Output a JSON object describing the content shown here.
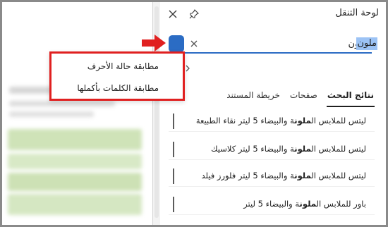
{
  "nav_pane": {
    "title": "لوحة التنقل",
    "close_icon": "close-icon",
    "pin_icon": "pin-icon"
  },
  "search": {
    "value": "ملون",
    "clear_icon": "close-icon",
    "options_icon": "chevron-icon"
  },
  "popup": {
    "items": [
      {
        "label": "مطابقة حالة الأحرف"
      },
      {
        "label": "مطابقة الكلمات بأكملها"
      }
    ]
  },
  "tabs": [
    {
      "label": "نتائج البحث",
      "active": true
    },
    {
      "label": "صفحات",
      "active": false
    },
    {
      "label": "خريطة المستند",
      "active": false
    }
  ],
  "results": [
    {
      "before": "ليتس للملابس ال",
      "match": "ملون",
      "after": "ة والبيضاء 5 ليتر نقاء الطبيعة"
    },
    {
      "before": "ليتس للملابس ال",
      "match": "ملون",
      "after": "ة والبيضاء 5 ليتر كلاسيك"
    },
    {
      "before": "ليتس للملابس ال",
      "match": "ملون",
      "after": "ة والبيضاء 5 ليتر فلورز فيلد"
    },
    {
      "before": "باور للملابس ال",
      "match": "ملون",
      "after": "ة والبيضاء 5 ليتر"
    }
  ],
  "colors": {
    "accent": "#2b6cc4",
    "annotation": "#e02020"
  }
}
